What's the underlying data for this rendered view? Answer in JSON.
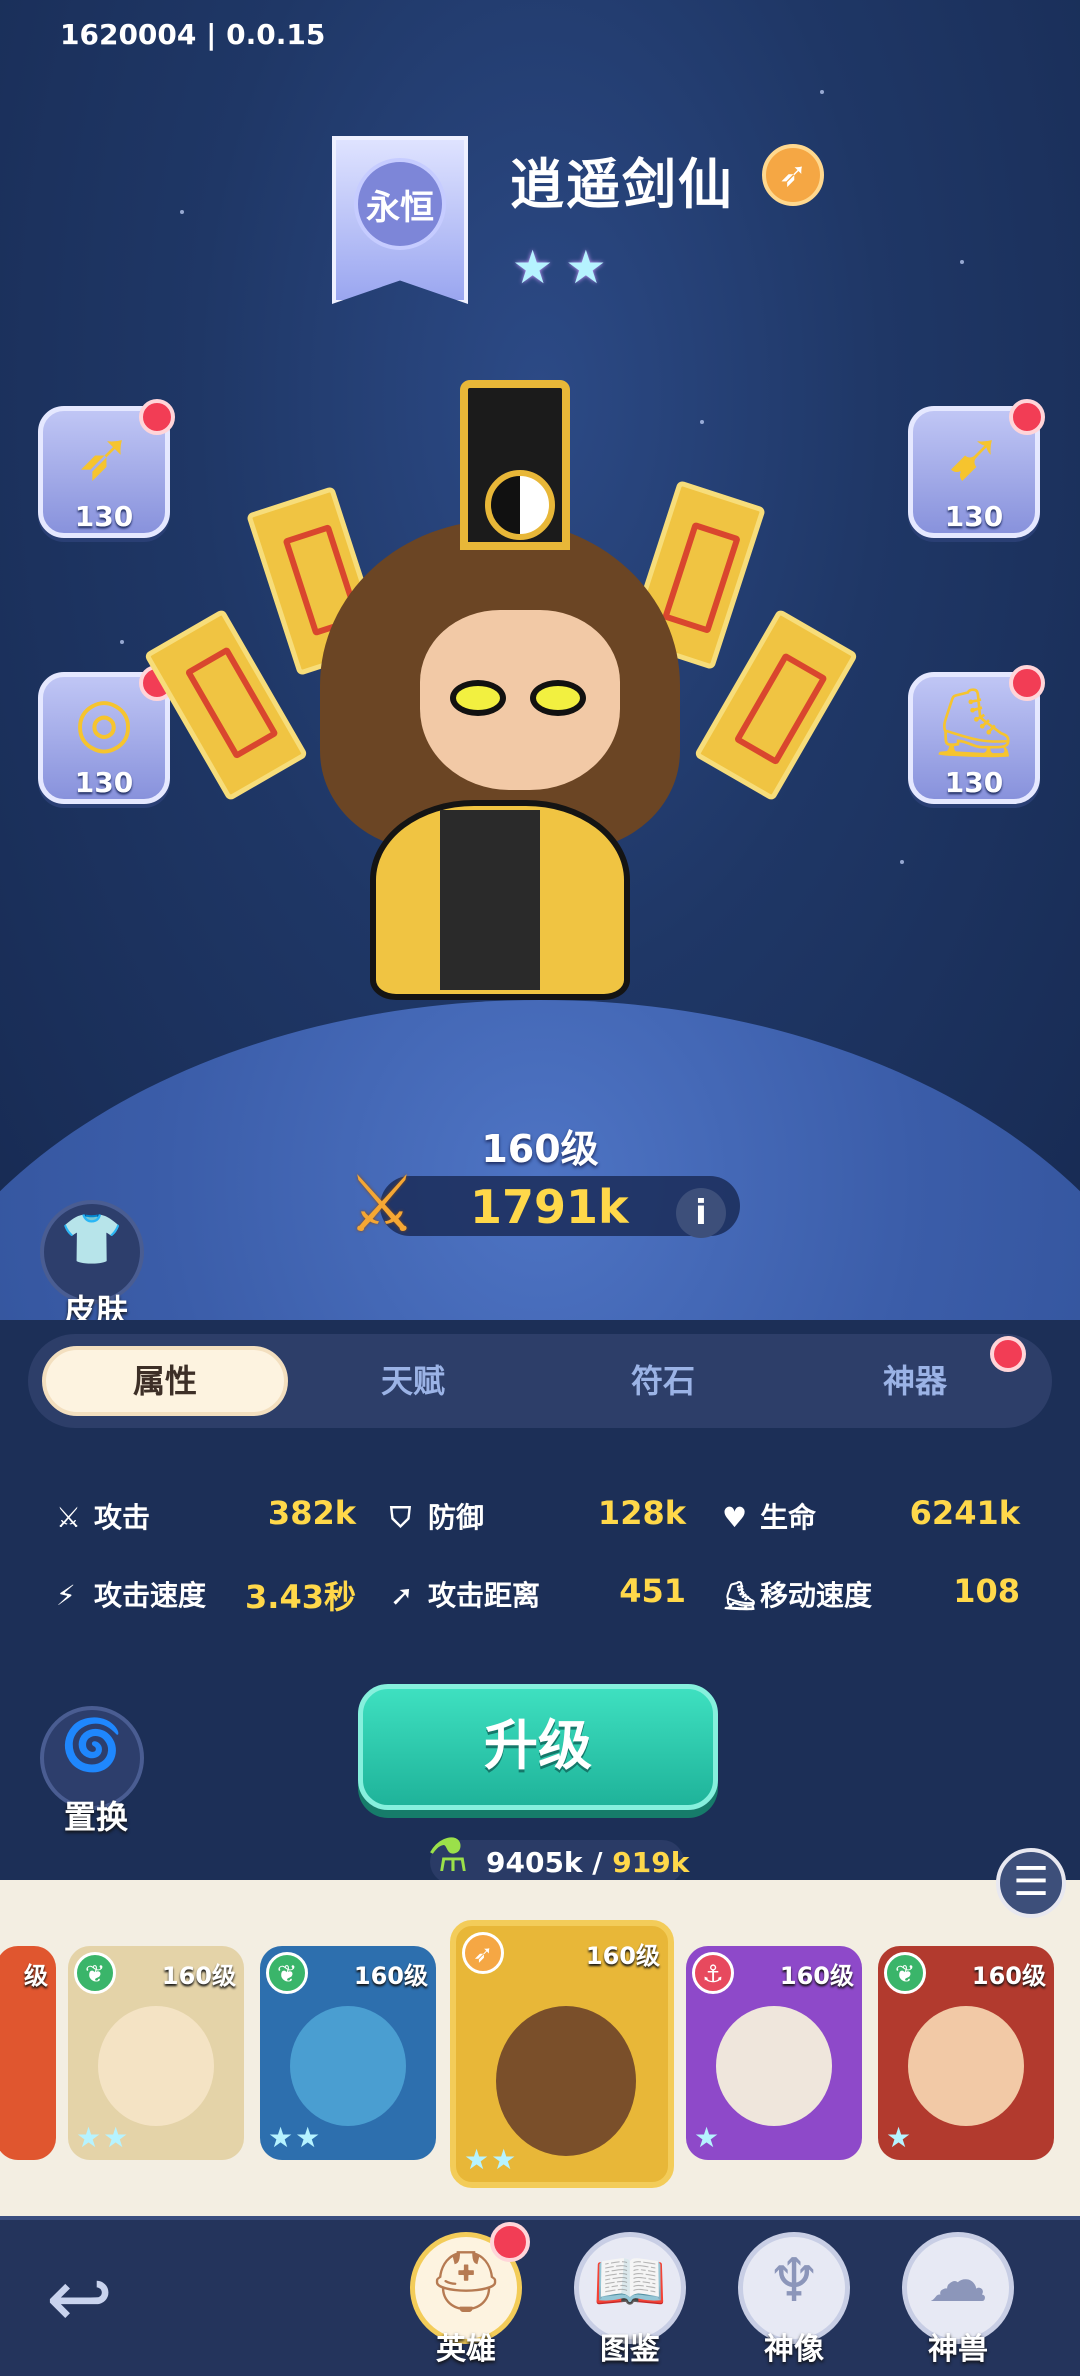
{
  "version": "1620004 | 0.0.15",
  "hero": {
    "rank": "永恒",
    "name": "逍遥剑仙",
    "class_icon": "bow-icon",
    "star_count": 2,
    "level": "160级",
    "power": "1791k"
  },
  "equipment": [
    {
      "icon": "bow-icon",
      "level": "130",
      "has_notice": true
    },
    {
      "icon": "quiver-icon",
      "level": "130",
      "has_notice": true
    },
    {
      "icon": "ring-icon",
      "level": "130",
      "has_notice": true
    },
    {
      "icon": "boot-icon",
      "level": "130",
      "has_notice": true
    }
  ],
  "side_buttons": {
    "skin": "皮肤",
    "swap": "置换"
  },
  "tabs": [
    {
      "label": "属性",
      "active": true
    },
    {
      "label": "天赋",
      "active": false
    },
    {
      "label": "符石",
      "active": false
    },
    {
      "label": "神器",
      "active": false,
      "has_notice": true
    }
  ],
  "stats": [
    {
      "label": "攻击",
      "value": "382k",
      "icon": "sword-icon"
    },
    {
      "label": "防御",
      "value": "128k",
      "icon": "shield-icon"
    },
    {
      "label": "生命",
      "value": "6241k",
      "icon": "heart-icon"
    },
    {
      "label": "攻击速度",
      "value": "3.43秒",
      "icon": "lightning-icon"
    },
    {
      "label": "攻击距离",
      "value": "451",
      "icon": "arrow-icon"
    },
    {
      "label": "移动速度",
      "value": "108",
      "icon": "boot-icon"
    }
  ],
  "upgrade": {
    "label": "升级",
    "current": "9405k",
    "separator": " / ",
    "required": "919k"
  },
  "roster": [
    {
      "level": "级",
      "badge": "",
      "stars": ""
    },
    {
      "level": "160级",
      "badge": "leaf-icon",
      "stars": "★★"
    },
    {
      "level": "160级",
      "badge": "leaf-icon",
      "stars": "★★"
    },
    {
      "level": "160级",
      "badge": "bow-icon",
      "stars": "★★",
      "selected": true
    },
    {
      "level": "160级",
      "badge": "anchor-icon",
      "stars": "★"
    },
    {
      "level": "160级",
      "badge": "leaf-icon",
      "stars": "★"
    }
  ],
  "nav": [
    {
      "label": "英雄",
      "active": true,
      "has_notice": true
    },
    {
      "label": "图鉴",
      "active": false
    },
    {
      "label": "神像",
      "active": false
    },
    {
      "label": "神兽",
      "active": false
    }
  ],
  "colors": {
    "accent_gold": "#ffd84a",
    "upgrade_green": "#2ccaad",
    "notice_red": "#f23d55",
    "background_navy": "#1c2f57"
  }
}
